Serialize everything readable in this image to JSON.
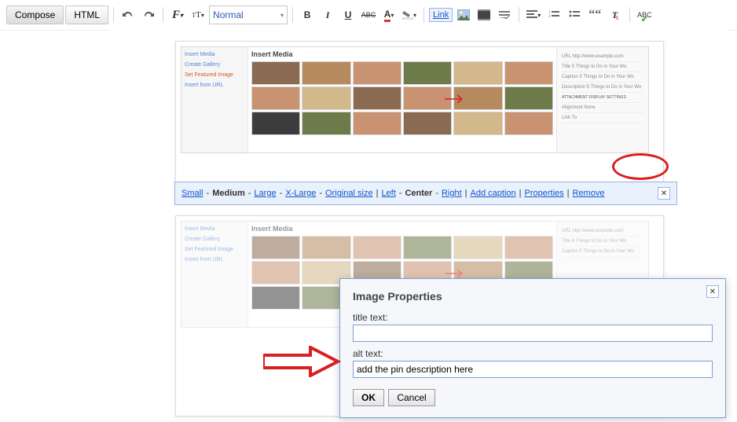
{
  "toolbar": {
    "compose": "Compose",
    "html": "HTML",
    "font_size_sel": "Normal",
    "bold": "B",
    "italic": "I",
    "underline": "U",
    "strike": "ABC",
    "link": "Link"
  },
  "img_toolbar": {
    "small": "Small",
    "medium": "Medium",
    "large": "Large",
    "xlarge": "X-Large",
    "original": "Original size",
    "left": "Left",
    "center": "Center",
    "right": "Right",
    "add_caption": "Add caption",
    "properties": "Properties",
    "remove": "Remove",
    "sep": " - ",
    "pipe": "  |  "
  },
  "media": {
    "title": "Insert Media",
    "side": [
      "Insert Media",
      "Create Gallery",
      "Set Featured Image",
      "Insert from URL"
    ],
    "right": [
      "URL  http://www.example.com",
      "Title  5 Things to Do in Your Wo",
      "Caption  5 Things to Do in Your Wo",
      "Description  5 Things to Do in Your Wo",
      "ATTACHMENT DISPLAY SETTINGS",
      "Alignment  None",
      "Link To"
    ]
  },
  "dialog": {
    "title": "Image Properties",
    "title_label": "title text:",
    "title_value": "",
    "alt_label": "alt text:",
    "alt_value": "add the pin description here",
    "ok": "OK",
    "cancel": "Cancel"
  }
}
